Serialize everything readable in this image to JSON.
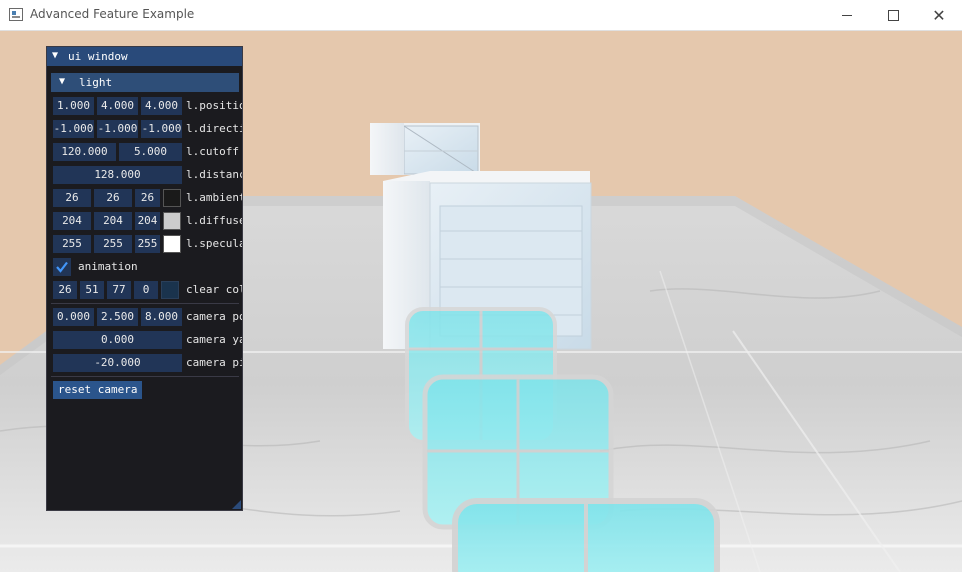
{
  "window": {
    "title": "Advanced Feature Example"
  },
  "ui_window": {
    "title": "ui window",
    "light_header": "light",
    "position": {
      "values": [
        "1.000",
        "4.000",
        "4.000"
      ],
      "label": "l.position"
    },
    "direction": {
      "values": [
        "-1.000",
        "-1.000",
        "-1.000"
      ],
      "label": "l.direction"
    },
    "cutoff": {
      "values": [
        "120.000",
        "5.000"
      ],
      "label": "l.cutoff"
    },
    "distance": {
      "value": "128.000",
      "label": "l.distance"
    },
    "ambient": {
      "values": [
        "26",
        "26",
        "26"
      ],
      "color": "#1a1a1a",
      "label": "l.ambient"
    },
    "diffuse": {
      "values": [
        "204",
        "204",
        "204"
      ],
      "color": "#cccccc",
      "label": "l.diffuse"
    },
    "specular": {
      "values": [
        "255",
        "255",
        "255"
      ],
      "color": "#ffffff",
      "label": "l.specular"
    },
    "animation": {
      "label": "animation",
      "checked": true
    },
    "clear_color": {
      "values": [
        "26",
        "51",
        "77",
        "0"
      ],
      "color": "#1a334d",
      "label": "clear color"
    },
    "camera_pos": {
      "values": [
        "0.000",
        "2.500",
        "8.000"
      ],
      "label": "camera pos"
    },
    "camera_yaw": {
      "value": "0.000",
      "label": "camera yaw"
    },
    "camera_pitch": {
      "value": "-20.000",
      "label": "camera pitch"
    },
    "reset_button": "reset camera"
  },
  "colors": {
    "background": "#e5c8ad",
    "imgui_title": "#294a7a",
    "imgui_header": "#2e4e78",
    "imgui_frame": "#213557",
    "imgui_button": "#2b558c"
  }
}
